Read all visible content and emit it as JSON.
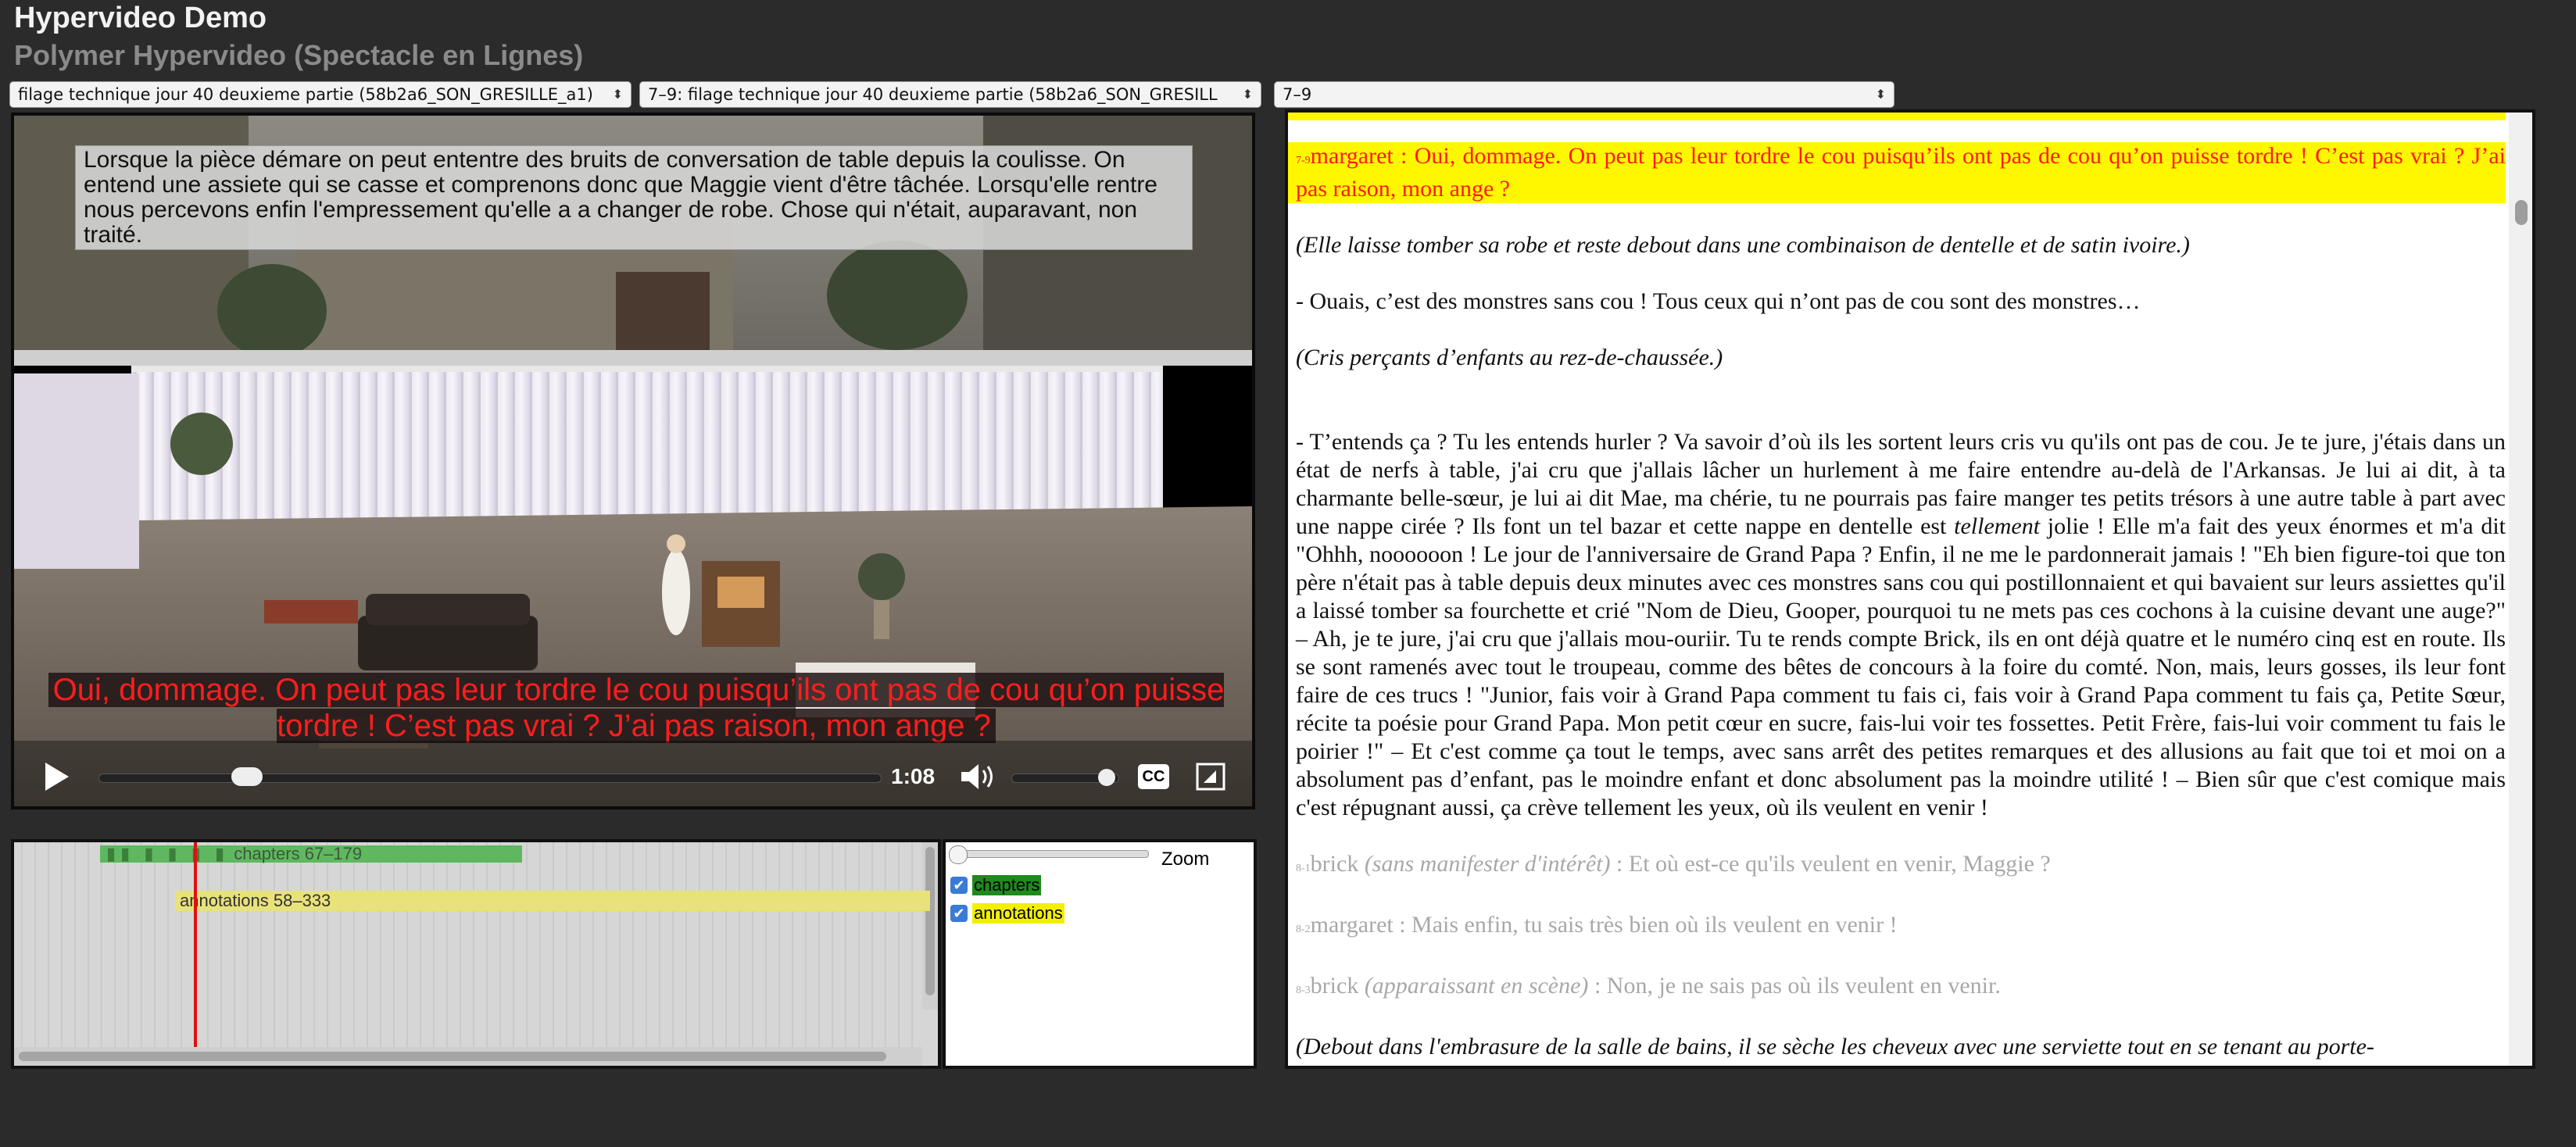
{
  "app": {
    "title": "Hypervideo Demo",
    "subtitle": "Polymer Hypervideo (Spectacle en Lignes)"
  },
  "selects": {
    "video_source": "filage technique jour 40 deuxieme partie (58b2a6_SON_GRESILLE_a1)",
    "chapter_source": "7–9: filage technique jour 40 deuxieme partie (58b2a6_SON_GRESILL",
    "chapter": "7–9"
  },
  "video": {
    "annotation_overlay": "Lorsque la pièce démare on peut ententre des bruits de conversation de table depuis la coulisse. On entend une assiete qui se casse et comprenons donc que Maggie vient d'être tâchée. Lorsqu'elle rentre nous percevons enfin l'empressement qu'elle a a changer de robe. Chose qui n'était, auparavant, non traité.",
    "subtitle": "Oui, dommage. On peut pas leur tordre le cou puisqu’ils ont pas de cou qu’on puisse tordre ! C’est pas vrai ? J’ai pas raison, mon ange ?",
    "time": "1:08",
    "cc_label": "CC",
    "progress": 0.19,
    "volume": 0.9
  },
  "timeline": {
    "chapters_label": "chapters 67–179",
    "annotations_label": "annotations 58–333",
    "playhead": 0.2
  },
  "timeline_panel": {
    "zoom_label": "Zoom",
    "chapters_toggle": "chapters",
    "annotations_toggle": "annotations"
  },
  "colors": {
    "chapters": "#5fb85f",
    "annotations": "#e8e27a",
    "active_highlight": "#fff700",
    "active_text": "#ff1a1a",
    "subtitle": "#ff1e1e"
  },
  "transcript": {
    "active_index": "7-9",
    "active_text": "margaret : Oui, dommage. On peut pas leur tordre le cou puisqu’ils ont pas de cou qu’on puisse tordre ! C’est pas vrai ? J’ai pas raison, mon ange ?",
    "direction_1": "(Elle laisse tomber sa robe et reste debout dans une combinaison de dentelle et de satin ivoire.)",
    "line_2": "- Ouais, c’est des monstres sans cou ! Tous ceux qui n’ont pas de cou sont des monstres…",
    "direction_2": "(Cris perçants d’enfants au rez-de-chaussée.)",
    "long_part1": "- T’entends ça ? Tu les entends hurler ? Va savoir d’où ils les sortent leurs cris vu qu'ils ont pas de cou. Je te jure, j'étais dans un état de nerfs à table, j'ai cru que j'allais lâcher un hurlement à me faire entendre au-delà de l'Arkansas. Je lui ai dit, à ta charmante belle-sœur, je lui ai dit Mae, ma chérie, tu ne pourrais pas faire manger tes petits trésors à une autre table à part avec une nappe cirée ? Ils font un tel bazar et cette nappe en dentelle est ",
    "long_em": "tellement",
    "long_part2": " jolie ! Elle m'a fait des yeux énormes et m'a dit \"Ohhh, noooooon ! Le jour de l'anniversaire de Grand Papa ? Enfin, il ne me le pardonnerait jamais ! \"Eh bien figure-toi que ton père n'était pas à table depuis deux minutes avec ces monstres sans cou qui postillonnaient et qui bavaient sur leurs assiettes qu'il a laissé tomber sa fourchette et crié \"Nom de Dieu, Gooper, pourquoi tu ne mets pas ces cochons à la cuisine devant une auge?\" – Ah, je te jure, j'ai cru que j'allais mou-ouriir. Tu te rends compte Brick, ils en ont déjà quatre et le numéro cinq est en route. Ils se sont ramenés avec tout le troupeau, comme des bêtes de concours à la foire du comté. Non, mais, leurs gosses, ils leur font faire de ces trucs ! \"Junior, fais voir à Grand Papa comment tu fais ci, fais voir à Grand Papa comment tu fais ça, Petite Sœur, récite ta poésie pour Grand Papa. Mon petit cœur en sucre, fais-lui voir tes fossettes. Petit Frère, fais-lui voir comment tu fais le poirier !\" – Et c'est comme ça tout le temps, avec sans arrêt des petites remarques et des allusions au fait que toi et moi on a absolument pas d’enfant, pas le moindre enfant et donc absolument pas la moindre utilité ! – Bien sûr que c'est comique mais c'est répugnant aussi, ça crève tellement les yeux, où ils veulent en venir !",
    "dim1_index": "8-1",
    "dim1_speaker": "brick ",
    "dim1_direction": "(sans manifester d'intérêt)",
    "dim1_text": " : Et où est-ce qu'ils veulent en venir, Maggie ?",
    "dim2_index": "8-2",
    "dim2_text": "margaret : Mais enfin, tu sais très bien où ils veulent en venir !",
    "dim3_index": "8-3",
    "dim3_speaker": "brick ",
    "dim3_direction": "(apparaissant en scène)",
    "dim3_text": " : Non, je ne sais pas où ils veulent en venir.",
    "bottom_direction": "(Debout dans l'embrasure de la salle de bains, il se sèche les cheveux avec une serviette tout en se tenant au porte-"
  }
}
